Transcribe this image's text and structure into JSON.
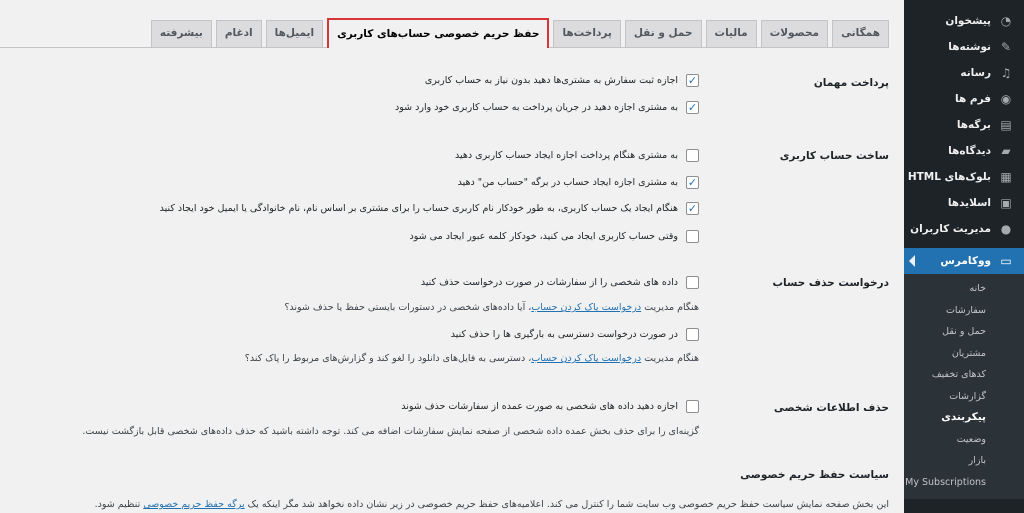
{
  "sidebar": {
    "items": [
      {
        "label": "پیشخوان",
        "icon": "dashboard-icon"
      },
      {
        "label": "نوشته‌ها",
        "icon": "pin-icon"
      },
      {
        "label": "رسانه",
        "icon": "media-icon"
      },
      {
        "label": "فرم ها",
        "icon": "forms-icon"
      },
      {
        "label": "برگه‌ها",
        "icon": "pages-icon"
      },
      {
        "label": "دیدگاه‌ها",
        "icon": "comments-icon"
      },
      {
        "label": "بلوک‌های HTML",
        "icon": "html-blocks-icon"
      },
      {
        "label": "اسلایدها",
        "icon": "slides-icon"
      },
      {
        "label": "مدیریت کاربران",
        "icon": "users-icon"
      }
    ],
    "active": {
      "label": "ووکامرس",
      "icon": "woocommerce-icon"
    },
    "submenu": [
      "خانه",
      "سفارشات",
      "حمل و نقل",
      "مشتریان",
      "کدهای تخفیف",
      "گزارشات",
      "پیکربندی",
      "وضعیت",
      "بازار",
      "My Subscriptions"
    ]
  },
  "tabs": [
    "همگانی",
    "محصولات",
    "مالیات",
    "حمل و نقل",
    "پرداخت‌ها",
    "حفظ حریم خصوصی حساب‌های کاربری",
    "ایمیل‌ها",
    "ادغام",
    "بیشرفته"
  ],
  "guest": {
    "label": "پرداخت مهمان",
    "opt1": "اجازه ثبت سفارش به مشتری‌ها دهید بدون نیاز به حساب کاربری",
    "opt2": "به مشتری اجازه دهید در جریان پرداخت به حساب کاربری خود وارد شود"
  },
  "account": {
    "label": "ساخت حساب کاربری",
    "opt1": "به مشتری هنگام پرداخت اجازه ایجاد حساب کاربری دهید",
    "opt2": "به مشتری اجازه ایجاد حساب در برگه \"حساب من\" دهید",
    "opt3": "هنگام ایجاد یک حساب کاربری، به طور خودکار نام کاربری حساب را برای مشتری بر اساس نام، نام خانوادگی یا ایمیل خود ایجاد کنید",
    "opt4": "وقتی حساب کاربری ایجاد می کنید، خودکار کلمه عبور ایجاد می شود"
  },
  "erasure": {
    "label": "درخواست حذف حساب",
    "opt1": "داده های شخصی را از سفارشات در صورت درخواست حذف کنید",
    "desc1_pre": "هنگام مدیریت",
    "desc1_link": "درخواست پاک کردن حساب",
    "desc1_post": "، آیا داده‌های شخصی در دستورات بایستی حفظ یا حذف شوند؟",
    "opt2": "در صورت درخواست دسترسی به بارگیری ها را حذف کنید",
    "desc2_pre": "هنگام مدیریت",
    "desc2_link": "درخواست پاک کردن حساب",
    "desc2_post": "، دسترسی به فایل‌های دانلود را لغو کند و گزارش‌های مربوط را پاک کند؟"
  },
  "personal": {
    "label": "حذف اطلاعات شخصی",
    "opt1": "اجازه دهید داده های شخصی به صورت عمده از سفارشات حذف شوند",
    "desc": "گزینه‌ای را برای حذف بخش عمده داده شخصی از صفحه نمایش سفارشات اضافه می کند. توجه داشته باشید که حذف داده‌های شخصی قابل بازگشت نیست."
  },
  "privacy": {
    "title": "سیاست حفظ حریم خصوصی",
    "desc_pre": "این بخش صفحه نمایش سیاست حفظ حریم خصوصی وب سایت شما را کنترل می کند. اعلامیه‌های حفظ حریم خصوصی در زیر نشان داده نخواهد شد مگر اینکه یک",
    "desc_link": "برگه حفظ حریم خصوصی",
    "desc_post": "تنظیم شود."
  },
  "colors": {
    "accent": "#2271b1",
    "sidebar": "#1d2327",
    "highlight": "#d63638"
  }
}
